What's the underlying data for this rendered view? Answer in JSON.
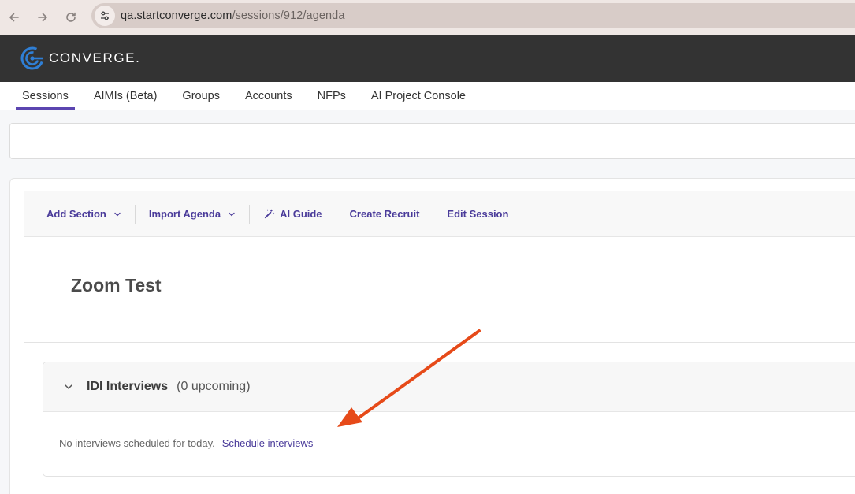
{
  "browser": {
    "url_host": "qa.startconverge.com",
    "url_path": "/sessions/912/agenda"
  },
  "app": {
    "brand": "CONVERGE."
  },
  "tabs": [
    {
      "label": "Sessions",
      "active": true
    },
    {
      "label": "AIMIs (Beta)",
      "active": false
    },
    {
      "label": "Groups",
      "active": false
    },
    {
      "label": "Accounts",
      "active": false
    },
    {
      "label": "NFPs",
      "active": false
    },
    {
      "label": "AI Project Console",
      "active": false
    }
  ],
  "toolbar": {
    "add_section": "Add Section",
    "import_agenda": "Import Agenda",
    "ai_guide": "AI Guide",
    "create_recruit": "Create Recruit",
    "edit_session": "Edit Session"
  },
  "session": {
    "title": "Zoom Test"
  },
  "section": {
    "name": "IDI Interviews",
    "count": "(0 upcoming)",
    "empty_text": "No interviews scheduled for today.",
    "link": "Schedule interviews"
  },
  "colors": {
    "accent": "#5b45b0",
    "link": "#4a3b9a",
    "header_bg": "#333333",
    "annotation_arrow": "#e64a19"
  }
}
